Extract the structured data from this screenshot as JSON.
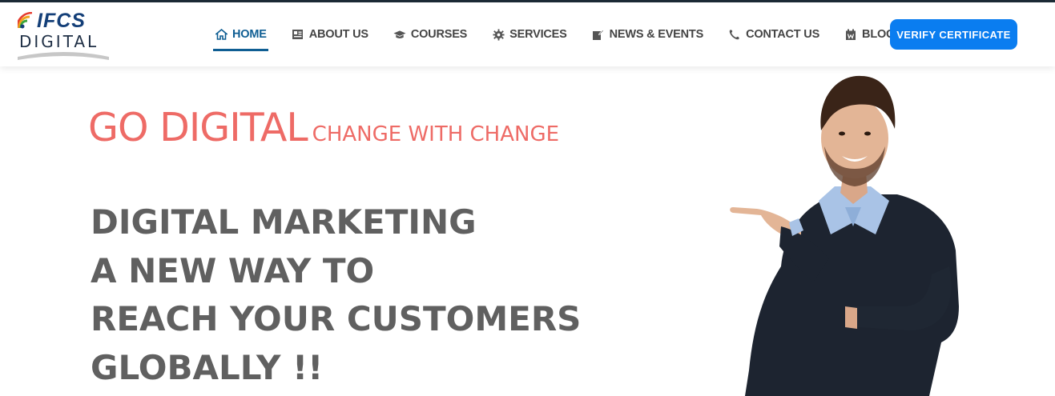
{
  "brand": {
    "logo_top": "IFCS",
    "logo_bottom": "DIGITAL"
  },
  "nav": {
    "items": [
      {
        "label": "HOME",
        "icon": "home-icon",
        "active": true
      },
      {
        "label": "ABOUT US",
        "icon": "address-card-icon",
        "active": false
      },
      {
        "label": "COURSES",
        "icon": "graduation-cap-icon",
        "active": false
      },
      {
        "label": "SERVICES",
        "icon": "gear-icon",
        "active": false
      },
      {
        "label": "NEWS & EVENTS",
        "icon": "edit-document-icon",
        "active": false
      },
      {
        "label": "CONTACT US",
        "icon": "phone-icon",
        "active": false
      },
      {
        "label": "BLOG",
        "icon": "calendar-icon",
        "active": false
      }
    ],
    "cta_label": "VERIFY CERTIFICATE"
  },
  "hero": {
    "tagline_big": "GO DIGITAL",
    "tagline_small": "CHANGE WITH CHANGE",
    "headline_lines": [
      "DIGITAL MARKETING",
      "A NEW WAY TO",
      "REACH YOUR CUSTOMERS",
      "GLOBALLY !!"
    ]
  },
  "colors": {
    "nav_active": "#0f5e93",
    "cta": "#0a7df0",
    "tagline": "#ee6b66",
    "headline": "#606060",
    "top_border": "#1c2b36"
  }
}
